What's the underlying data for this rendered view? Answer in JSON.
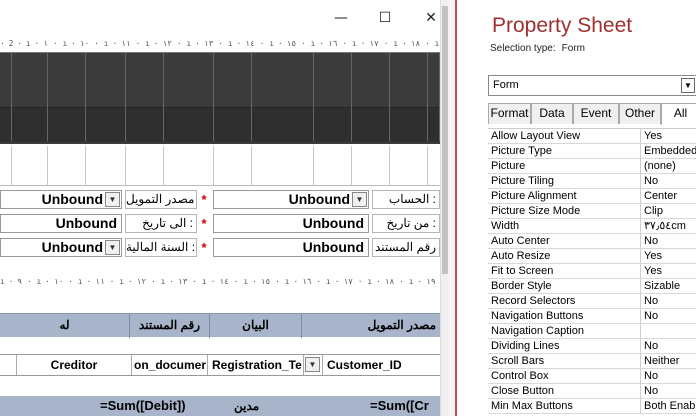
{
  "window": {
    "minimize_glyph": "—",
    "maximize_glyph": "☐",
    "close_glyph": "✕"
  },
  "rulers": {
    "top": "· 2 · ı · ١ · ı · ١٠ · ı · ١١ · ı · ١٢ · ı · ١٣ · ı · ١٤ · ı · ١٥ · ı · ١٦ · ı · ١٧ · ı · ١٨ · ı · ١٩ · ı · ٢٠ ·",
    "middle": "ı · ٩ · ı · ١٠ · ı · ١١ · ı · ١٢ · ı · ١٣ · ı · ١٤ · ı · ١٥ · ı · ١٦ · ı · ١٧ · ı · ١٨ · ı · ١٩ · ı · ٢٠ · ı"
  },
  "filters": {
    "row1": {
      "left_value": "Unbound",
      "left_label": "مصدر التمويل",
      "right_value": "Unbound",
      "right_label": "الحساب :"
    },
    "row2": {
      "left_value": "Unbound",
      "left_label": "الى تاريخ :",
      "right_value": "Unbound",
      "right_label": "من تاريخ :"
    },
    "row3": {
      "left_value": "Unbound",
      "left_label": "السنة المالية :",
      "right_value": "Unbound",
      "right_label": "رقم المستند"
    },
    "required_mark": "*"
  },
  "section_headers": [
    "له",
    "رقم المستند",
    "البيان",
    "مصدر التمويل"
  ],
  "detail_fields": [
    "Creditor",
    "on_documer",
    "Registration_Te",
    "Customer_ID"
  ],
  "footer": {
    "sum_debit": "=Sum([Debit])",
    "label_debit": "مدين",
    "sum_credit": "=Sum([Cr"
  },
  "property_sheet": {
    "title": "Property Sheet",
    "selection_type_label": "Selection type:",
    "selection_type_value": "Form",
    "selector_value": "Form",
    "tabs": [
      "Format",
      "Data",
      "Event",
      "Other",
      "All"
    ],
    "active_tab": "All",
    "properties": [
      {
        "name": "Allow Layout View",
        "value": "Yes"
      },
      {
        "name": "Picture Type",
        "value": "Embedded"
      },
      {
        "name": "Picture",
        "value": "(none)"
      },
      {
        "name": "Picture Tiling",
        "value": "No"
      },
      {
        "name": "Picture Alignment",
        "value": "Center"
      },
      {
        "name": "Picture Size Mode",
        "value": "Clip"
      },
      {
        "name": "Width",
        "value": "٣٧٫٥٤cm"
      },
      {
        "name": "Auto Center",
        "value": "No"
      },
      {
        "name": "Auto Resize",
        "value": "Yes"
      },
      {
        "name": "Fit to Screen",
        "value": "Yes"
      },
      {
        "name": "Border Style",
        "value": "Sizable"
      },
      {
        "name": "Record Selectors",
        "value": "No"
      },
      {
        "name": "Navigation Buttons",
        "value": "No"
      },
      {
        "name": "Navigation Caption",
        "value": ""
      },
      {
        "name": "Dividing Lines",
        "value": "No"
      },
      {
        "name": "Scroll Bars",
        "value": "Neither"
      },
      {
        "name": "Control Box",
        "value": "No"
      },
      {
        "name": "Close Button",
        "value": "No"
      },
      {
        "name": "Min Max Buttons",
        "value": "Both Enab"
      }
    ]
  },
  "colors": {
    "title_accent": "#a03030",
    "section_band": "#a7b4c9",
    "header_band": "#3a3a3a",
    "required_star": "#d00000"
  }
}
